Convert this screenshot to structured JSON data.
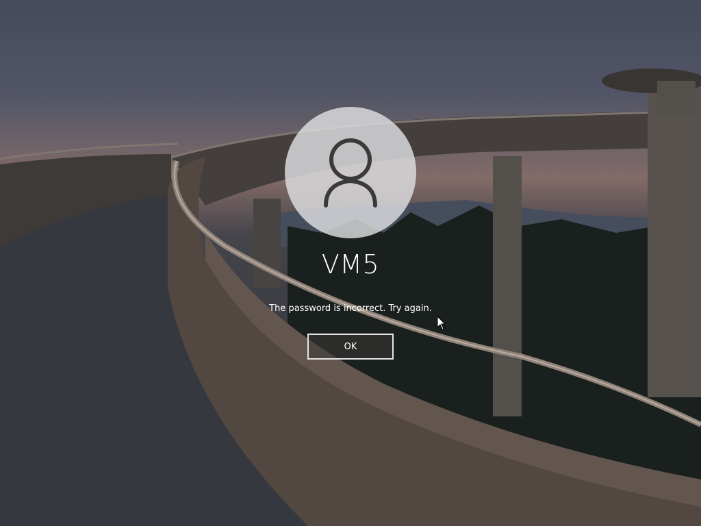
{
  "lock_screen": {
    "username": "VM5",
    "error_message": "The password is incorrect. Try again.",
    "ok_label": "OK"
  },
  "icons": {
    "avatar": "user-avatar-icon",
    "cursor": "mouse-pointer-icon"
  },
  "colors": {
    "text": "#ffffff",
    "button_border": "#e6e6e6",
    "avatar_bg": "#dedee0"
  }
}
